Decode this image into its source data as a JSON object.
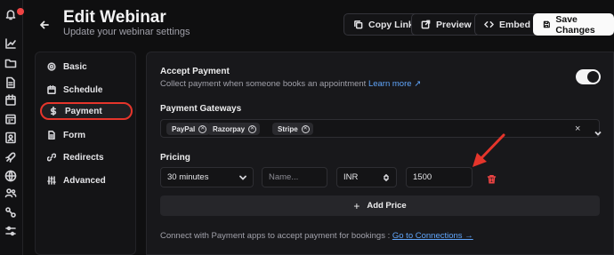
{
  "header": {
    "title": "Edit Webinar",
    "subtitle": "Update your webinar settings",
    "buttons": {
      "copy_link": "Copy Link",
      "preview": "Preview",
      "embed": "Embed",
      "save": "Save Changes"
    }
  },
  "nav": {
    "items": [
      {
        "label": "Basic",
        "icon": "gear-icon"
      },
      {
        "label": "Schedule",
        "icon": "calendar-icon"
      },
      {
        "label": "Payment",
        "icon": "dollar-icon",
        "active": true
      },
      {
        "label": "Form",
        "icon": "document-icon"
      },
      {
        "label": "Redirects",
        "icon": "link-icon"
      },
      {
        "label": "Advanced",
        "icon": "sliders-icon"
      }
    ]
  },
  "payment": {
    "accept_title": "Accept Payment",
    "accept_desc": "Collect payment when someone books an appointment",
    "learn_more": "Learn more",
    "accept_enabled": true,
    "gateways_title": "Payment Gateways",
    "gateways": [
      "PayPal",
      "Razorpay",
      "Stripe"
    ],
    "clear_symbol": "×",
    "pricing_title": "Pricing",
    "pricing": {
      "duration": "30 minutes",
      "name_placeholder": "Name...",
      "currency": "INR",
      "amount": "1500"
    },
    "add_price": "Add Price",
    "footer_text": "Connect with Payment apps to accept payment for bookings :",
    "footer_link": "Go to Connections →"
  },
  "colors": {
    "accent_link": "#60a5fa",
    "highlight": "#e5352b",
    "danger": "#ef4444"
  }
}
